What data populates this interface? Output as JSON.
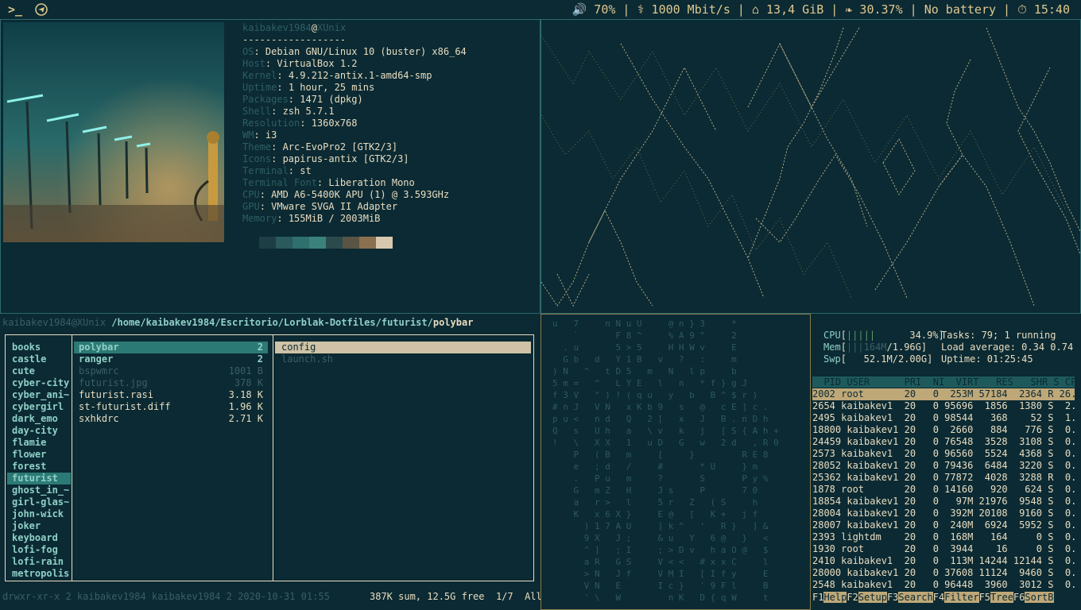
{
  "topbar": {
    "left_icons": [
      "terminal-icon",
      "telegram-icon"
    ],
    "status": "🔊 70% | ⚕ 1000 Mbit/s | ⌂ 13,4 GiB | ❧ 30.37% | No battery | ⏱ 15:40"
  },
  "neofetch": {
    "user": "kaibakev1984",
    "at": "@",
    "host": "XUnix",
    "rule": "------------------",
    "fields": [
      {
        "k": "OS",
        "v": "Debian GNU/Linux 10 (buster) x86_64"
      },
      {
        "k": "Host",
        "v": "VirtualBox 1.2"
      },
      {
        "k": "Kernel",
        "v": "4.9.212-antix.1-amd64-smp"
      },
      {
        "k": "Uptime",
        "v": "1 hour, 25 mins"
      },
      {
        "k": "Packages",
        "v": "1471 (dpkg)"
      },
      {
        "k": "Shell",
        "v": "zsh 5.7.1"
      },
      {
        "k": "Resolution",
        "v": "1360x768"
      },
      {
        "k": "WM",
        "v": "i3"
      },
      {
        "k": "Theme",
        "v": "Arc-EvoPro2 [GTK2/3]"
      },
      {
        "k": "Icons",
        "v": "papirus-antix [GTK2/3]"
      },
      {
        "k": "Terminal",
        "v": "st"
      },
      {
        "k": "Terminal Font",
        "v": "Liberation Mono"
      },
      {
        "k": "CPU",
        "v": "AMD A6-5400K APU (1) @ 3.593GHz"
      },
      {
        "k": "GPU",
        "v": "VMware SVGA II Adapter"
      },
      {
        "k": "Memory",
        "v": "155MiB / 2003MiB"
      }
    ],
    "swatches": [
      "#1e3e46",
      "#2a5a5c",
      "#2f6f6d",
      "#3b827c",
      "#2a4a4c",
      "#5a5444",
      "#8a7050",
      "#d8c8b0"
    ]
  },
  "ranger": {
    "userhost": "kaibakev1984@XUnix",
    "path": "/home/kaibakev1984/Escritorio/Lorblak-Dotfiles/futurist/",
    "current": "polybar",
    "parent": [
      "books",
      "castle",
      "cute",
      "cyber-city",
      "cyber_ani~",
      "cybergirl",
      "dark_emo",
      "day-city",
      "flamie",
      "flower",
      "forest",
      "futurist",
      "ghost_in_~",
      "girl-glas~",
      "john-wick",
      "joker",
      "keyboard",
      "lofi-fog",
      "lofi-rain",
      "metropolis"
    ],
    "parent_selected": "futurist",
    "current_dir": [
      {
        "name": "polybar",
        "info": "2",
        "kind": "sel"
      },
      {
        "name": "ranger",
        "info": "2",
        "kind": "dir"
      },
      {
        "name": "bspwmrc",
        "info": "1001 B",
        "kind": "dim"
      },
      {
        "name": "futurist.jpg",
        "info": "378 K",
        "kind": "dim"
      },
      {
        "name": "futurist.rasi",
        "info": "3.18 K",
        "kind": "file"
      },
      {
        "name": "st-futurist.diff",
        "info": "1.96 K",
        "kind": "file"
      },
      {
        "name": "sxhkdrc",
        "info": "2.71 K",
        "kind": "file"
      }
    ],
    "preview": [
      {
        "name": "config",
        "kind": "sel"
      },
      {
        "name": "launch.sh",
        "kind": "dim"
      }
    ],
    "status_left": "drwxr-xr-x 2 kaibakev1984 kaibakev1984 2 2020-10-31 01:55",
    "status_right": "387K sum, 12.5G free  1/7  All"
  },
  "htop": {
    "cpu_label": "CPU",
    "cpu_val": "34.9%",
    "mem_label": "Mem",
    "mem_val": "1.96G",
    "mem_used": "164M",
    "swp_label": "Swp",
    "swp_val": "52.1M/2.00G",
    "tasks": "Tasks: 79; 1 running",
    "load": "Load average: 0.34 0.74",
    "uptime": "Uptime: 01:25:45",
    "header": "  PID USER      PRI  NI  VIRT   RES   SHR S CPU",
    "rows": [
      "2002 root       20   0  253M 57184  2364 R 26.",
      "2654 kaibakev1  20   0 95696  1856  1380 S  2.",
      "2495 kaibakev1  20   0 98544   368    52 S  1.",
      "18800 kaibakev1 20   0  2660   884   776 S  0.",
      "24459 kaibakev1 20   0 76548  3528  3108 S  0.",
      "2573 kaibakev1  20   0 96560  5524  4368 S  0.",
      "28052 kaibakev1 20   0 79436  6484  3220 S  0.",
      "25362 kaibakev1 20   0 77872  4028  3288 R  0.",
      "1878 root       20   0 14160   920   624 S  0.",
      "18854 kaibakev1 20   0   97M 21976  9548 S  0.",
      "28004 kaibakev1 20   0  392M 20108  9160 S  0.",
      "28007 kaibakev1 20   0  240M  6924  5952 S  0.",
      "2393 lightdm    20   0  168M   164     0 S  0.",
      "1930 root       20   0  3944    16     0 S  0.",
      "2410 kaibakev1  20   0  113M 14244 12144 S  0.",
      "28000 kaibakev1 20   0 37608 11124  9460 S  0.",
      "2548 kaibakev1  20   0 96448  3960  3012 S  0."
    ],
    "footer": [
      {
        "k": "F1",
        "l": "Help"
      },
      {
        "k": "F2",
        "l": "Setup"
      },
      {
        "k": "F3",
        "l": "Search"
      },
      {
        "k": "F4",
        "l": "Filter"
      },
      {
        "k": "F5",
        "l": "Tree"
      },
      {
        "k": "F6",
        "l": "SortB"
      }
    ]
  },
  "matrix": {
    "lines": [
      "u   7     n N u U     @ n } 3     *",
      "    `       F 8 ^     % A 9 \"     2",
      "  . u       5 > 5     H H W v     E",
      "  G b   d   Y 1 B   v   ?   :     m",
      ") N   ^   t D 5   m   N   l p     b",
      "5 m =   ^   L Y E   l   n   * f } g J",
      "f 3 V   \" ) ! ( q u   y   b   B ^ $ r )",
      "# n J   V N   x K b 9   s   @   c E ] c .",
      "p u <   n d   Q   2 [   x   J   B . n D h",
      "Q   s   U h   a   \\ v   k   j   [ S { A h +",
      "!   \\   X X   1   u D   G   w   2 d   , R 0",
      "    P   ( B   m     [     }         R E 8",
      "    e   ; d   /     #       * U     } m",
      "    .   P u   m     ?       S       P y %",
      "    G   m Z   H     J s     P       7 0",
      "    a   r >   l     5 r   Z   ( S     h",
      "    K   x 6 X }     E @   [   K +   j f",
      "      ) 1 7 A U     ] k ^   '   R }   ] &",
      "      9 X   J ;     & u   Y   6 @   }   <",
      "      ^ ]   ; I     ; > D v   h a O @   $",
      "      a R   G S     V < <   # x x C     l",
      "      > N   J f     V M I   [ I f y     E",
      "      V N   E       I c }   ' 9 F l     B",
      "      ' \\   W         n K   D { q W     t"
    ]
  }
}
